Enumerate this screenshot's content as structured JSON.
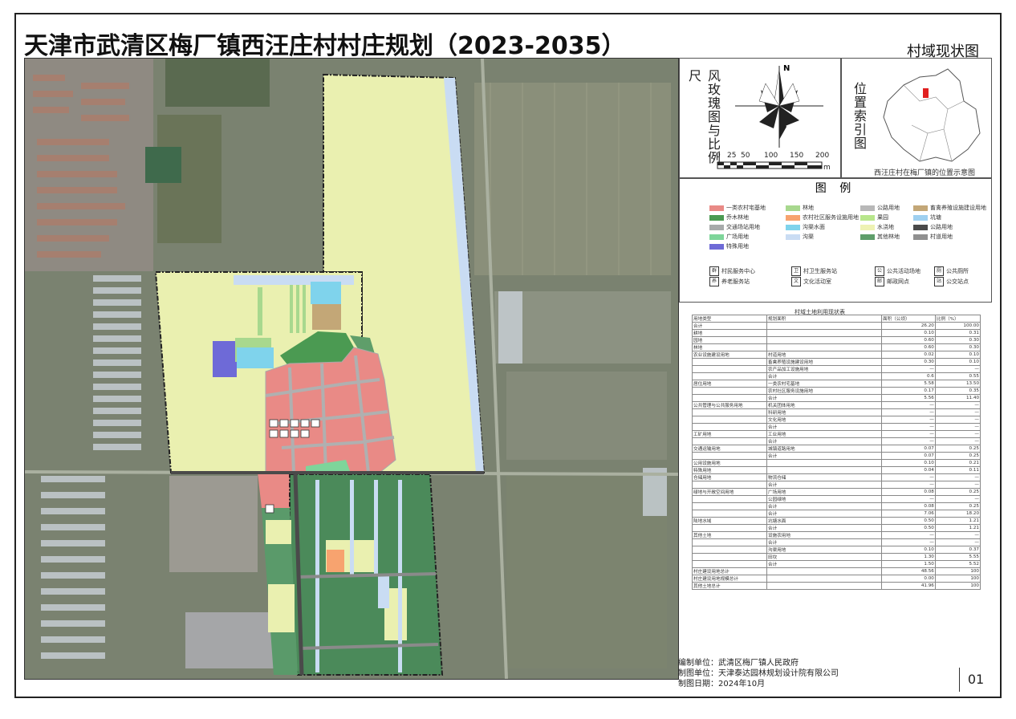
{
  "title": "天津市武清区梅厂镇西汪庄村村庄规划（2023-2035）",
  "subtitle": "村域现状图",
  "compass": {
    "label": "风玫瑰图与比例尺",
    "north": "N"
  },
  "scale": {
    "ticks": [
      "0",
      "25",
      "50",
      "100",
      "150",
      "200"
    ],
    "unit": "m"
  },
  "locator": {
    "label": "位置索引图",
    "caption": "西汪庄村在梅厂镇的位置示意图"
  },
  "legend": {
    "title": "图 例",
    "items": [
      {
        "label": "一类农村宅基地",
        "color": "#e98a86"
      },
      {
        "label": "林地",
        "color": "#a8d88e"
      },
      {
        "label": "公路用地",
        "color": "#b8b8b8"
      },
      {
        "label": "畜禽养殖设施建设用地",
        "color": "#c3a777"
      },
      {
        "label": "乔木林地",
        "color": "#4b9a52"
      },
      {
        "label": "农村社区服务设施用地",
        "color": "#f7a36f"
      },
      {
        "label": "果园",
        "color": "#b8e68c"
      },
      {
        "label": "坑塘",
        "color": "#9fd0f0"
      },
      {
        "label": "交通场站用地",
        "color": "#a7aaaa"
      },
      {
        "label": "沟渠水面",
        "color": "#7fd3ec"
      },
      {
        "label": "水浇地",
        "color": "#eef2b3"
      },
      {
        "label": "公路用地",
        "color": "#4a4a4a"
      },
      {
        "label": "广场用地",
        "color": "#7ed59a"
      },
      {
        "label": "沟渠",
        "color": "#c9dcf3"
      },
      {
        "label": "其他林地",
        "color": "#5f9e6a"
      },
      {
        "label": "村道用地",
        "color": "#909090"
      },
      {
        "label": "特殊用地",
        "color": "#6e6ad7"
      }
    ],
    "symbols": [
      {
        "icon": "群",
        "label": "村民服务中心"
      },
      {
        "icon": "卫",
        "label": "村卫生服务站"
      },
      {
        "icon": "公",
        "label": "公共活动场地"
      },
      {
        "icon": "厕",
        "label": "公共厕所"
      },
      {
        "icon": "养",
        "label": "养老服务站"
      },
      {
        "icon": "文",
        "label": "文化活动室"
      },
      {
        "icon": "邮",
        "label": "邮政网点"
      },
      {
        "icon": "站",
        "label": "公交站点"
      }
    ]
  },
  "land_table": {
    "caption": "村域土地利用现状表",
    "headers": [
      "用地类型",
      "规划面积",
      "面积（公顷）",
      "比例（%）"
    ],
    "rows": [
      [
        "合计",
        "",
        "26.20",
        "100.00"
      ],
      [
        "耕地",
        "",
        "0.10",
        "0.31"
      ],
      [
        "园地",
        "",
        "0.60",
        "0.30"
      ],
      [
        "林地",
        "",
        "0.60",
        "0.30"
      ],
      [
        "农业设施建设用地",
        "村道用地",
        "0.02",
        "0.10"
      ],
      [
        "",
        "畜禽养殖设施建设用地",
        "0.30",
        "0.10"
      ],
      [
        "",
        "农产品加工设施用地",
        "—",
        "—"
      ],
      [
        "",
        "合计",
        "0.6",
        "0.55"
      ],
      [
        "居住用地",
        "一类农村宅基地",
        "5.58",
        "13.50"
      ],
      [
        "",
        "农村社区服务设施用地",
        "0.17",
        "0.35"
      ],
      [
        "",
        "合计",
        "5.56",
        "11.40"
      ],
      [
        "公共管理与公共服务用地",
        "机关团体用地",
        "—",
        "—"
      ],
      [
        "",
        "科研用地",
        "—",
        "—"
      ],
      [
        "",
        "文化用地",
        "—",
        "—"
      ],
      [
        "",
        "合计",
        "—",
        "—"
      ],
      [
        "工矿用地",
        "工业用地",
        "—",
        "—"
      ],
      [
        "",
        "合计",
        "—",
        "—"
      ],
      [
        "交通运输用地",
        "城镇道路用地",
        "0.07",
        "0.25"
      ],
      [
        "",
        "合计",
        "0.07",
        "0.25"
      ],
      [
        "公用设施用地",
        "",
        "0.10",
        "0.21"
      ],
      [
        "特殊用地",
        "",
        "0.04",
        "0.11"
      ],
      [
        "仓储用地",
        "物流仓储",
        "—",
        "—"
      ],
      [
        "",
        "合计",
        "—",
        "—"
      ],
      [
        "绿地与开敞空间用地",
        "广场用地",
        "0.08",
        "0.25"
      ],
      [
        "",
        "公园绿地",
        "—",
        "—"
      ],
      [
        "",
        "合计",
        "0.08",
        "0.25"
      ],
      [
        "",
        "合计",
        "7.06",
        "18.20"
      ],
      [
        "陆地水域",
        "坑塘水面",
        "0.50",
        "1.21"
      ],
      [
        "",
        "合计",
        "0.50",
        "1.21"
      ],
      [
        "其他土地",
        "设施农用地",
        "—",
        "—"
      ],
      [
        "",
        "合计",
        "—",
        "—"
      ],
      [
        "",
        "沟渠用地",
        "0.10",
        "0.37"
      ],
      [
        "",
        "田坎",
        "1.30",
        "5.55"
      ],
      [
        "",
        "合计",
        "1.50",
        "5.52"
      ],
      [
        "村庄建设用地总计",
        "",
        "48.56",
        "100"
      ],
      [
        "村庄建设用地规模总计",
        "",
        "0.00",
        "100"
      ],
      [
        "其他土地总计",
        "",
        "41.96",
        "100"
      ]
    ]
  },
  "footer": {
    "line1": "编制单位：武清区梅厂镇人民政府",
    "line2": "制图单位：天津泰达园林规划设计院有限公司",
    "line3": "制图日期：2024年10月",
    "page": "01"
  }
}
